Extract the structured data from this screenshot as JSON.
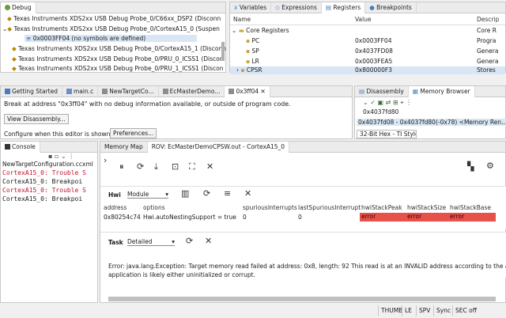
{
  "debug": {
    "tab_label": "Debug",
    "items": [
      "Texas Instruments XDS2xx USB Debug Probe_0/C66xx_DSP2 (Disconn",
      "Texas Instruments XDS2xx USB Debug Probe_0/CortexA15_0 (Suspen",
      "0x0003FF04  (no symbols are defined)",
      "Texas Instruments XDS2xx USB Debug Probe_0/CortexA15_1 (Disconn",
      "Texas Instruments XDS2xx USB Debug Probe_0/PRU_0_ICSS1 (Discon",
      "Texas Instruments XDS2xx USB Debug Probe_0/PRU_1_ICSS1 (Discon"
    ]
  },
  "registers_view": {
    "tabs": [
      "Variables",
      "Expressions",
      "Registers",
      "Breakpoints"
    ],
    "columns": [
      "Name",
      "Value",
      "Descrip"
    ],
    "group": "Core Registers",
    "group_desc": "Core R",
    "rows": [
      {
        "name": "PC",
        "value": "0x0003FF04",
        "desc": "Progra"
      },
      {
        "name": "SP",
        "value": "0x4037FD08",
        "desc": "Genera"
      },
      {
        "name": "LR",
        "value": "0x0003FEA5",
        "desc": "Genera"
      },
      {
        "name": "CPSR",
        "value": "0x800000F3",
        "desc": "Stores"
      }
    ]
  },
  "editor": {
    "tabs": [
      "Getting Started",
      "main.c",
      "NewTargetCo...",
      "EcMasterDemo...",
      "0x3ff04"
    ],
    "message": "Break at address \"0x3ff04\" with no debug information available, or outside of program code.",
    "view_disassembly": "View Disassembly...",
    "configure_text": "Configure when this editor is shown",
    "preferences": "Preferences..."
  },
  "right_panel": {
    "tabs": [
      "Disassembly",
      "Memory Browser"
    ],
    "address_input": "0x4037fd80",
    "range": "0x4037fd08 - 0x4037fd80(-0x78) <Memory Ren...",
    "format": "32-Bit Hex - TI Style"
  },
  "console": {
    "tab_label": "Console",
    "file": "NewTargetConfiguration.ccxml",
    "lines": [
      {
        "text": "CortexA15_0: Trouble S",
        "err": true
      },
      {
        "text": "CortexA15_0: Breakpoi",
        "err": false
      },
      {
        "text": "CortexA15_0: Trouble S",
        "err": true
      },
      {
        "text": "CortexA15_0: Breakpoi",
        "err": false
      }
    ]
  },
  "memory_map": {
    "tabs": [
      "Memory Map",
      "ROV: EcMasterDemoCPSW.out - CortexA15_0"
    ],
    "hwi_label": "Hwi",
    "hwi_select": "Module",
    "columns": [
      "address",
      "options",
      "spuriousInterrupts",
      "lastSpuriousInterrupt",
      "hwiStackPeak",
      "hwiStackSize",
      "hwiStackBase"
    ],
    "row": [
      "0x80254c74",
      "Hwi.autoNestingSupport = true",
      "0",
      "0",
      "error",
      "error",
      "error"
    ],
    "task_label": "Task",
    "task_select": "Detailed",
    "error_line1": "Error: java.lang.Exception: Target memory read failed at address: 0x8, length: 92 This read is at an INVALID address according to the applica",
    "error_line2": "application is likely either uninitialized or corrupt."
  },
  "status_bar": [
    "THUMB",
    "LE",
    "SPV",
    "Sync",
    "SEC off"
  ],
  "colors": {
    "error": "#e8504a",
    "console_error": "#c8102e",
    "selection": "#d9e6f5"
  }
}
